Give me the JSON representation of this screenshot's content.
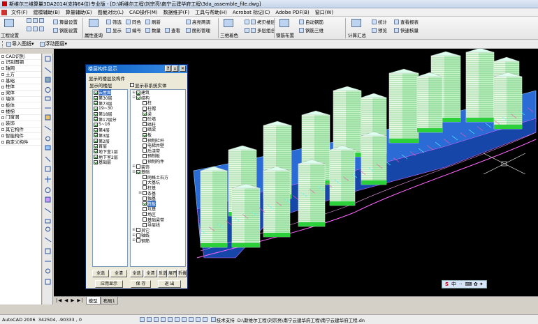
{
  "window": {
    "title": "斯维尔三维算量3DA2014(支持64位)专业版 - [D:\\斯维尔工程\\刘宗亮\\南宁云建华府工程\\3da_assemble_file.dwg]"
  },
  "menu": [
    "文件(F)",
    "建模辅助(B)",
    "算量辅助(E)",
    "图截对比(L)",
    "CAD操作(M)",
    "数据维护(F)",
    "工具与帮助(H)",
    "Acrobat 标记(C)",
    "Adobe PDF(B)",
    "窗口(W)"
  ],
  "toolbar": {
    "project_settings": "工程设置",
    "calc_settings": "算量设置",
    "rebar_settings": "钢筋设置",
    "attr_query": "属性查询",
    "filter": "筛选",
    "id_color": "同色",
    "refresh": "刷新",
    "show": "显示",
    "number": "编号",
    "count": "数量",
    "check": "查看",
    "resolve": "图形管理",
    "reinforce_paste": "高亮两调",
    "view3d": "三维着色",
    "copy_floor": "拷贝楼层",
    "multi_combine": "多层组合",
    "rebar_layout": "钢筋布置",
    "auto_rebar": "自动钢筋",
    "rebar_3d": "钢筋三维",
    "calc_summary": "计算汇总",
    "stats": "统计",
    "preview": "预览",
    "quick_check": "快速核量",
    "check_report": "查看报表"
  },
  "toolbar2": {
    "import_drawing": "导入图纸",
    "float_drawing": "浮动图层"
  },
  "left_panel": [
    "CAD识别",
    "识别图钢",
    "轴网",
    "土方",
    "基础",
    "柱体",
    "梁体",
    "墙体",
    "板体",
    "楼梯",
    "门窗洞",
    "装饰",
    "其它构件",
    "智能构件",
    "自定义构件"
  ],
  "dialog": {
    "title": "楼层构件显示",
    "group_label": "显示的楼层及构件",
    "floors_label": "显示的楼层",
    "hide_sys_label": "显示非系统实体",
    "floors": [
      {
        "name": "云屋面",
        "checked": true,
        "selected": true
      },
      {
        "name": "第30层",
        "checked": true
      },
      {
        "name": "第73层",
        "checked": true
      },
      {
        "name": "19~30",
        "checked": true
      },
      {
        "name": "第18层",
        "checked": true
      },
      {
        "name": "第17层分",
        "checked": true
      },
      {
        "name": "5~16",
        "checked": true
      },
      {
        "name": "第4层",
        "checked": true
      },
      {
        "name": "第3层",
        "checked": true
      },
      {
        "name": "第2层",
        "checked": true
      },
      {
        "name": "首层",
        "checked": true
      },
      {
        "name": "地下室1层",
        "checked": true
      },
      {
        "name": "地下室2层",
        "checked": true
      },
      {
        "name": "基础层",
        "checked": true
      }
    ],
    "tree": [
      {
        "label": "建筑",
        "level": 0,
        "exp": "+",
        "checked": true
      },
      {
        "label": "结构",
        "level": 0,
        "exp": "-",
        "checked": true
      },
      {
        "label": "柱",
        "level": 1,
        "exp": "",
        "checked": false
      },
      {
        "label": "柱帽",
        "level": 1,
        "exp": "",
        "checked": false
      },
      {
        "label": "梁",
        "level": 1,
        "exp": "",
        "checked": true
      },
      {
        "label": "砼墙",
        "level": 1,
        "exp": "",
        "checked": false
      },
      {
        "label": "暗柱",
        "level": 1,
        "exp": "",
        "checked": false
      },
      {
        "label": "暗梁",
        "level": 1,
        "exp": "",
        "checked": false
      },
      {
        "label": "板",
        "level": 1,
        "exp": "",
        "checked": true
      },
      {
        "label": "预制栏杆",
        "level": 1,
        "exp": "",
        "checked": false
      },
      {
        "label": "电梯井壁",
        "level": 1,
        "exp": "",
        "checked": false
      },
      {
        "label": "后浇带",
        "level": 1,
        "exp": "",
        "checked": false
      },
      {
        "label": "预制板",
        "level": 1,
        "exp": "",
        "checked": false
      },
      {
        "label": "预制构件",
        "level": 1,
        "exp": "",
        "checked": false
      },
      {
        "label": "装饰",
        "level": 0,
        "exp": "+",
        "checked": false
      },
      {
        "label": "基础",
        "level": 0,
        "exp": "-",
        "checked": true
      },
      {
        "label": "网格土石方",
        "level": 1,
        "exp": "",
        "checked": false
      },
      {
        "label": "大基坑",
        "level": 1,
        "exp": "",
        "checked": false
      },
      {
        "label": "柱基",
        "level": 1,
        "exp": "",
        "checked": false
      },
      {
        "label": "条基",
        "level": 1,
        "exp": "+",
        "checked": false
      },
      {
        "label": "独基",
        "level": 1,
        "exp": "",
        "checked": false
      },
      {
        "label": "筏板",
        "level": 1,
        "exp": "",
        "checked": true,
        "selected": true
      },
      {
        "label": "坑基",
        "level": 1,
        "exp": "",
        "checked": false
      },
      {
        "label": "场区",
        "level": 1,
        "exp": "",
        "checked": false
      },
      {
        "label": "基础梁带",
        "level": 1,
        "exp": "",
        "checked": false
      },
      {
        "label": "导层线",
        "level": 1,
        "exp": "",
        "checked": false
      },
      {
        "label": "其它",
        "level": 0,
        "exp": "+",
        "checked": false
      },
      {
        "label": "轴线",
        "level": 0,
        "exp": "+",
        "checked": false
      },
      {
        "label": "钢筋",
        "level": 0,
        "exp": "+",
        "checked": false
      }
    ],
    "buttons": {
      "all1": "全选",
      "clear1": "全清",
      "all2": "全选",
      "clear2": "全清",
      "invert": "反选",
      "expand": "展开",
      "collapse": "折叠",
      "apply": "应用显示",
      "save": "保 存",
      "exit": "退 出"
    }
  },
  "tabs": {
    "model": "模型",
    "layout": "布局1"
  },
  "status": {
    "app": "AutoCAD 2006",
    "coords": "342504, -90333 , 0",
    "support": "技术支持",
    "path": "D:\\斯维尔工程\\刘宗亮\\南宁云建华府工程\\南宁云建华府工程.dn"
  },
  "ime": [
    "中",
    "··"
  ]
}
